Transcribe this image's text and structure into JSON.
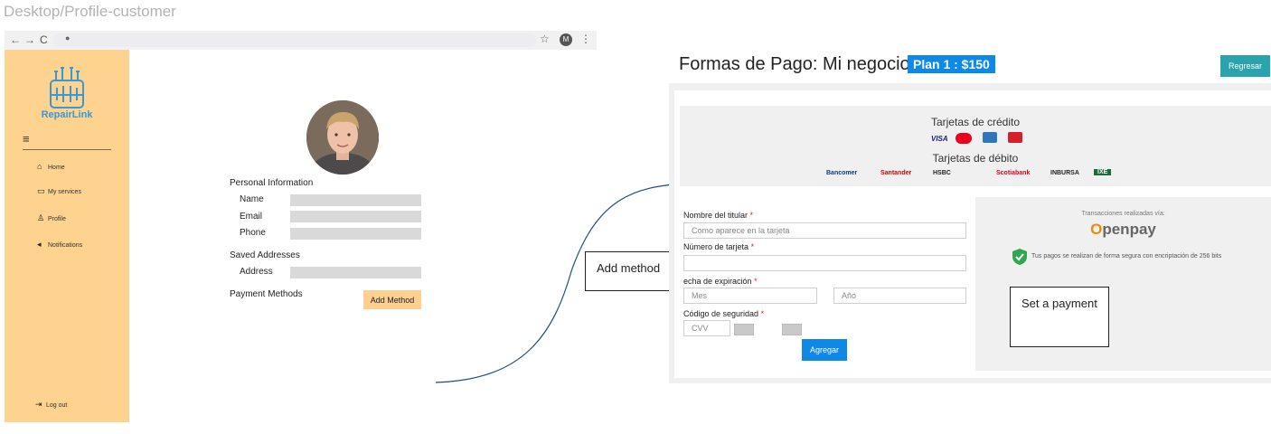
{
  "frame_title": "Desktop/Profile-customer",
  "browser": {
    "nav_back": "←",
    "nav_forward": "→",
    "nav_reload": "C",
    "account_initial": "M"
  },
  "sidebar": {
    "brand": "RepairLink",
    "items": [
      {
        "label": "Home",
        "icon": "home-icon"
      },
      {
        "label": "My services",
        "icon": "folder-icon"
      },
      {
        "label": "Profile",
        "icon": "person-icon"
      },
      {
        "label": "Notifications",
        "icon": "megaphone-icon"
      }
    ],
    "logout": {
      "label": "Log out",
      "icon": "logout-icon"
    }
  },
  "profile": {
    "personal_title": "Personal Information",
    "name_label": "Name",
    "email_label": "Email",
    "phone_label": "Phone",
    "addresses_title": "Saved Addresses",
    "address_label": "Address",
    "payment_title": "Payment Methods",
    "add_method_button": "Add Method"
  },
  "callouts": {
    "add_method": "Add method",
    "set_payment": "Set a payment"
  },
  "payment": {
    "title": "Formas de Pago: Mi negocio",
    "plan_badge": "Plan 1 : $150",
    "back_button": "Regresar",
    "credit_heading": "Tarjetas de crédito",
    "debit_heading": "Tarjetas de débito",
    "credit_brands": [
      "VISA"
    ],
    "debit_brands": [
      "Bancomer",
      "Santander",
      "HSBC",
      "Scotiabank",
      "INBURSA",
      "IXE"
    ],
    "holder_label": "Nombre del titular",
    "holder_placeholder": "Como aparece en la tarjeta",
    "card_number_label": "Número de tarjeta",
    "expiry_label": "echa de expiración",
    "month_placeholder": "Mes",
    "year_placeholder": "Año",
    "cvv_label": "Código de seguridad",
    "cvv_placeholder": "CVV",
    "required_mark": "*",
    "submit_button": "Agregar",
    "openpay_caption": "Transacciones realizadas vía:",
    "openpay_brand_o": "O",
    "openpay_brand_rest": "penpay",
    "secure_text": "Tus pagos se realizan de forma segura con encriptación de 256 bits"
  },
  "colors": {
    "sidebar": "#fed28f",
    "accent_blue": "#0e8ae6",
    "teal": "#2aa3ad",
    "brand_blue": "#3a98d4"
  }
}
